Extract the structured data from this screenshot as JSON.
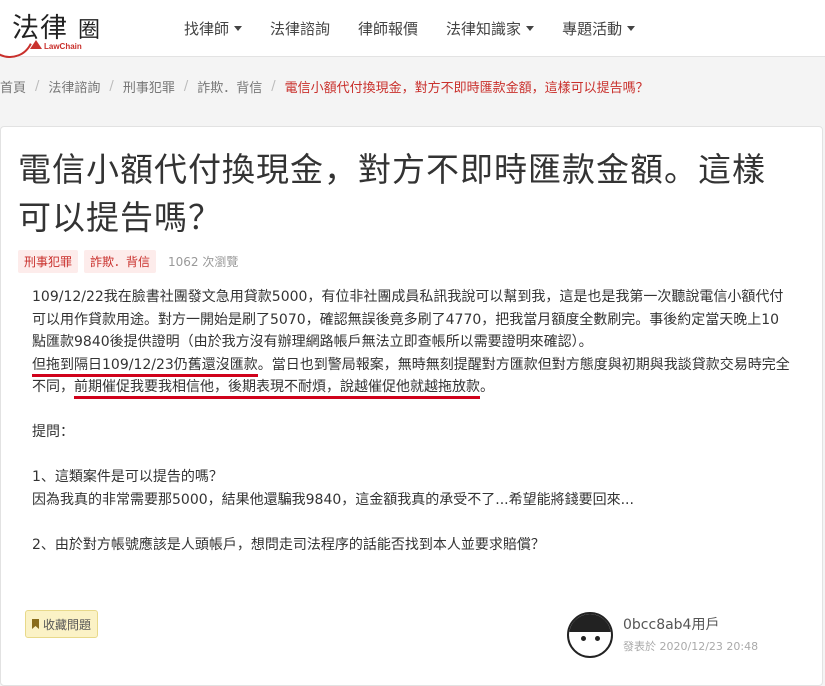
{
  "logo": {
    "main": "法律",
    "box": "圈",
    "sub": "LawChain"
  },
  "nav": [
    {
      "label": "找律師",
      "dropdown": true
    },
    {
      "label": "法律諮詢",
      "dropdown": false
    },
    {
      "label": "律師報價",
      "dropdown": false
    },
    {
      "label": "法律知識家",
      "dropdown": true
    },
    {
      "label": "專題活動",
      "dropdown": true
    }
  ],
  "breadcrumb": [
    "首頁",
    "法律諮詢",
    "刑事犯罪",
    "詐欺．背信",
    "電信小額代付換現金，對方不即時匯款金額，這樣可以提告嗎？"
  ],
  "post": {
    "title": "電信小額代付換現金，對方不即時匯款金額。這樣可以提告嗎？",
    "tags": [
      "刑事犯罪",
      "詐欺．背信"
    ],
    "views": "1062 次瀏覽",
    "p1": "109/12/22我在臉書社團發文急用貸款5000，有位非社團成員私訊我說可以幫到我，這是也是我第一次聽說電信小額代付可以用作貸款用途。對方一開始是刷了5070，確認無誤後竟多刷了4770，把我當月額度全數刷完。事後約定當天晚上10點匯款9840後提供證明（由於我方沒有辦理網路帳戶無法立即查帳所以需要證明來確認）。",
    "p2_hl1": "但拖到隔日109/12/23仍舊還沒匯款",
    "p2_mid": "。當日也到警局報案，無時無刻提醒對方匯款但對方態度與初期與我談貸款交易時完全不同，",
    "p2_hl2": "前期催促我要我相信他，後期表現不耐煩，說越催促他就越拖放款",
    "p2_end": "。",
    "q_label": "提問：",
    "q1": "1、這類案件是可以提告的嗎？",
    "q1_detail": "因為我真的非常需要那5000，結果他還騙我9840，這金額我真的承受不了...希望能將錢要回來...",
    "q2": "2、由於對方帳號應該是人頭帳戶，想問走司法程序的話能否找到本人並要求賠償？",
    "collect_label": "收藏問題",
    "author": "0bcc8ab4用戶",
    "published": "發表於 2020/12/23 20:48"
  }
}
